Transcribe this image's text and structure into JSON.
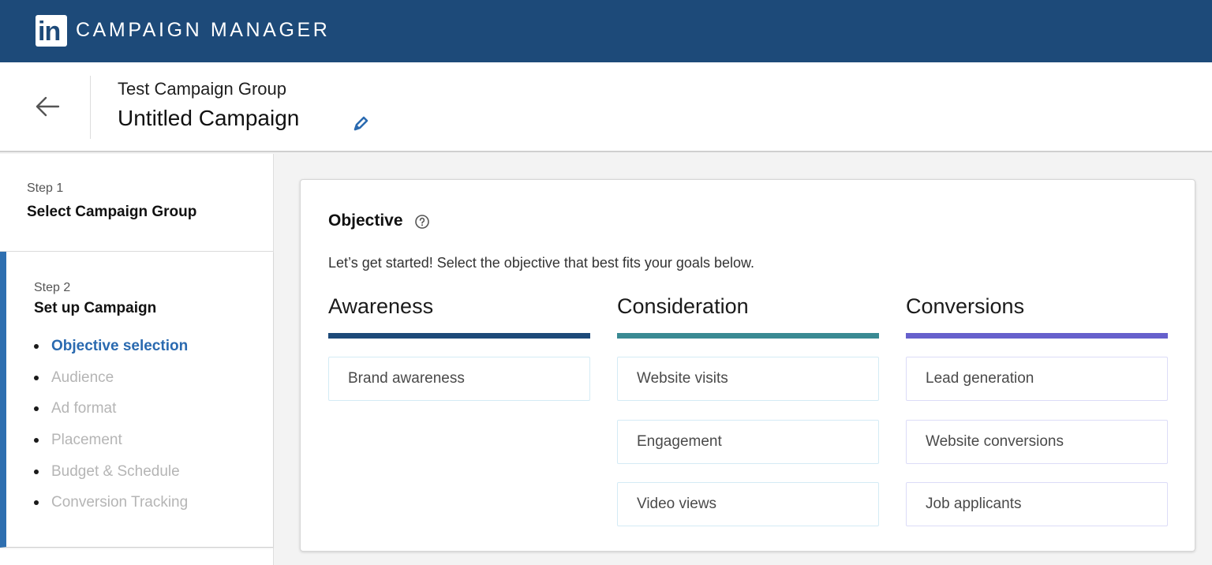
{
  "app": {
    "logo_text": "in",
    "title": "CAMPAIGN MANAGER",
    "brand_color": "#1d4a79"
  },
  "header": {
    "back_icon": "arrow-left-icon",
    "campaign_group": "Test Campaign Group",
    "campaign_name": "Untitled Campaign",
    "edit_icon": "pencil-icon"
  },
  "sidebar": {
    "step1": {
      "label": "Step 1",
      "title": "Select Campaign Group"
    },
    "step2": {
      "label": "Step 2",
      "title": "Set up Campaign",
      "substeps": [
        {
          "label": "Objective selection",
          "active": true
        },
        {
          "label": "Audience",
          "active": false
        },
        {
          "label": "Ad format",
          "active": false
        },
        {
          "label": "Placement",
          "active": false
        },
        {
          "label": "Budget & Schedule",
          "active": false
        },
        {
          "label": "Conversion Tracking",
          "active": false
        }
      ]
    },
    "accent_color": "#2e6fb0"
  },
  "objective": {
    "title": "Objective",
    "help_icon": "question-circle-icon",
    "intro": "Let’s get started! Select the objective that best fits your goals below.",
    "columns": [
      {
        "title": "Awareness",
        "color": "#1d4a79",
        "options": [
          "Brand awareness"
        ]
      },
      {
        "title": "Consideration",
        "color": "#3a8a93",
        "options": [
          "Website visits",
          "Engagement",
          "Video views"
        ]
      },
      {
        "title": "Conversions",
        "color": "#6660cc",
        "options": [
          "Lead generation",
          "Website conversions",
          "Job applicants"
        ]
      }
    ]
  }
}
